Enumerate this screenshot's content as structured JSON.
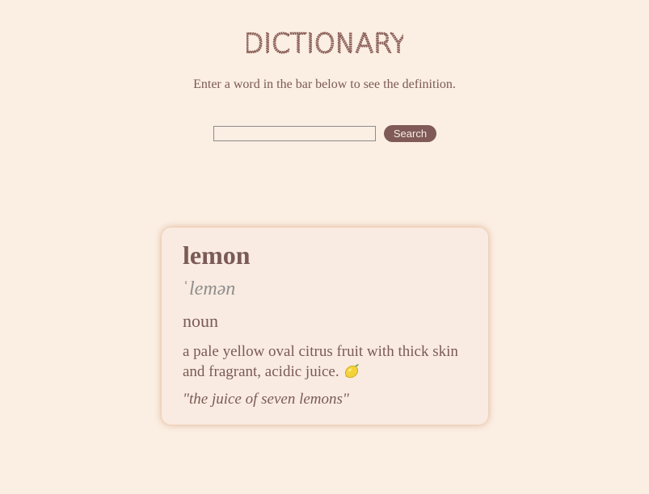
{
  "header": {
    "title": "DICTIONARY",
    "subtitle": "Enter a word in the bar below to see the definition."
  },
  "search": {
    "value": "",
    "placeholder": "",
    "button_label": "Search"
  },
  "result": {
    "word": "lemon",
    "phonetic": "ˈlemən",
    "part_of_speech": "noun",
    "definition": "a pale yellow oval citrus fruit with thick skin and fragrant, acidic juice.",
    "definition_icon": "lemon-icon",
    "example": "\"the juice of seven lemons\""
  },
  "colors": {
    "background": "#fbeee3",
    "text": "#7b5a55",
    "button": "#7f5a56",
    "phonetic": "#8e8e8e",
    "card_shadow": "#d7a078"
  }
}
